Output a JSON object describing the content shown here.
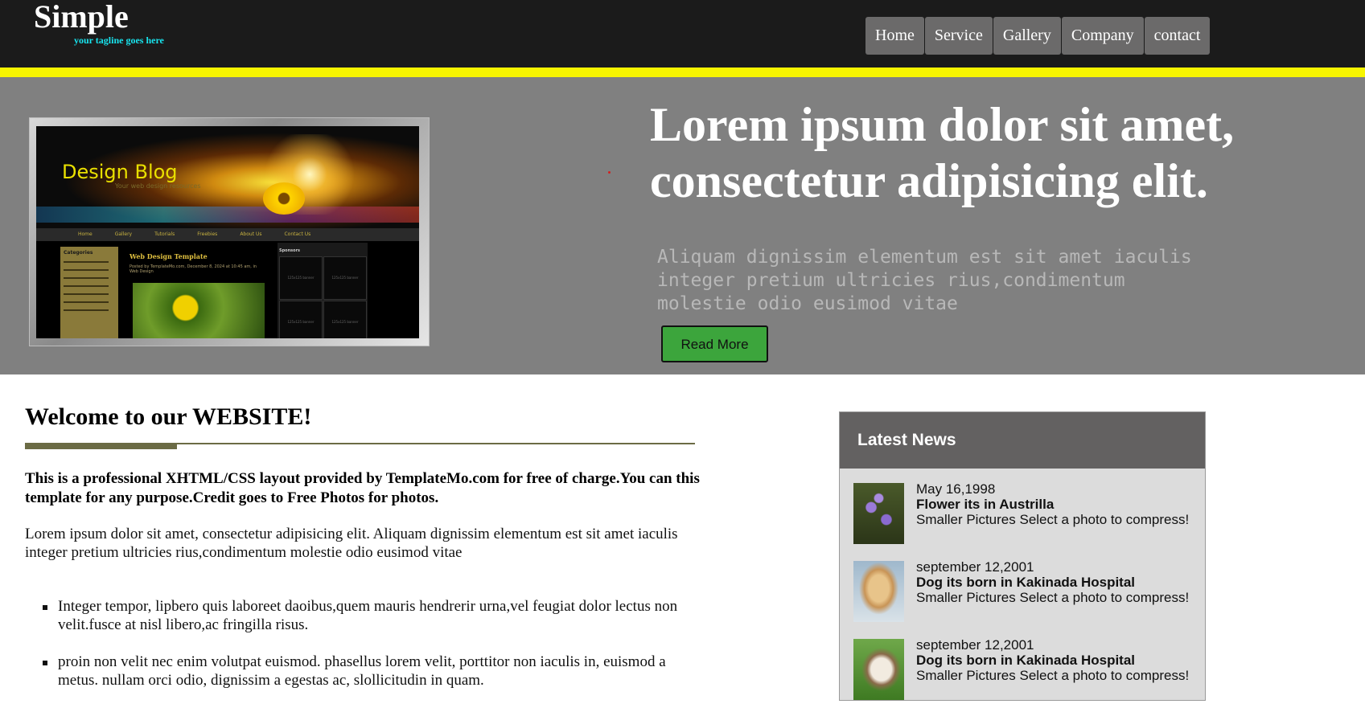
{
  "header": {
    "logo": "Simple",
    "tagline": "your tagline goes here",
    "nav": [
      "Home",
      "Service",
      "Gallery",
      "Company",
      "contact"
    ]
  },
  "hero": {
    "screenshot": {
      "title": "Design Blog",
      "subtitle": "Your web design resources",
      "nav": [
        "Home",
        "Gallery",
        "Tutorials",
        "Freebies",
        "About Us",
        "Contact Us"
      ],
      "sidebar_title": "Categories",
      "post_title": "Web Design Template",
      "post_meta": "Posted by TemplateMo.com, December 8, 2024 at 10:45 am, in Web Design",
      "sponsors_title": "Sponsors",
      "banner_label": "125x125 banner"
    },
    "title": "Lorem ipsum dolor sit amet, consectetur adipisicing elit.",
    "text": "Aliquam dignissim elementum est sit amet iaculis integer pretium ultricies rius,condimentum molestie odio eusimod vitae",
    "button": "Read More"
  },
  "main": {
    "heading": "Welcome to our WEBSITE!",
    "intro": "This is a professional XHTML/CSS layout provided by TemplateMo.com for free of charge.You can this template for any purpose.Credit goes to Free Photos for photos.",
    "paragraph": "Lorem ipsum dolor sit amet, consectetur adipisicing elit. Aliquam dignissim elementum est sit amet iaculis integer pretium ultricies rius,condimentum molestie odio eusimod vitae",
    "bullets": [
      "Integer tempor, lipbero quis laboreet daoibus,quem mauris hendrerir urna,vel feugiat dolor lectus non velit.fusce at nisl libero,ac fringilla risus.",
      "proin non velit nec enim volutpat euismod. phasellus lorem velit, porttitor non iaculis in, euismod a metus. nullam orci odio, dignissim a egestas ac, slollicitudin in quam."
    ]
  },
  "sidebar": {
    "title": "Latest News",
    "items": [
      {
        "date": "May 16,1998",
        "title": "Flower its in Austrilla",
        "desc": "Smaller Pictures Select a photo to compress!",
        "thumb": "flower"
      },
      {
        "date": "september 12,2001",
        "title": "Dog its born in Kakinada Hospital",
        "desc": "Smaller Pictures Select a photo to compress!",
        "thumb": "dog"
      },
      {
        "date": "september 12,2001",
        "title": "Dog its born in Kakinada Hospital",
        "desc": "Smaller Pictures Select a photo to compress!",
        "thumb": "cat"
      }
    ]
  }
}
